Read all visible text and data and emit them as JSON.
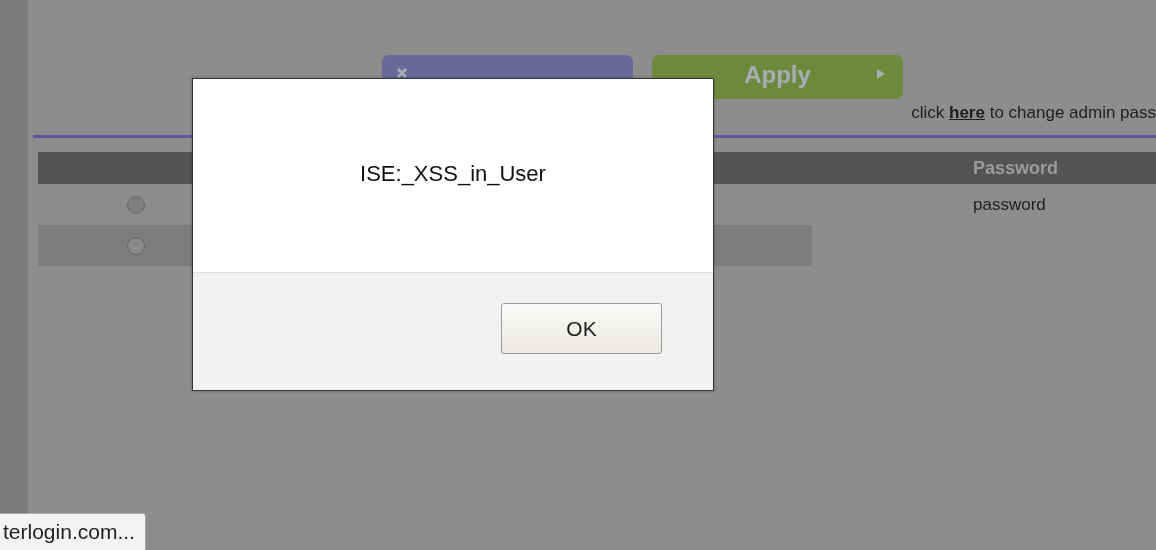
{
  "actions": {
    "buttons": [
      {
        "kind": "cancel"
      },
      {
        "kind": "apply",
        "label": "Apply"
      }
    ],
    "link_text": "click **here** to change admin pass"
  },
  "table": {
    "columns": [
      {
        "label": "Password"
      }
    ],
    "rows": [
      {
        "selected": false,
        "password": "password"
      },
      {
        "selected": false,
        "password": ""
      }
    ]
  },
  "dialog": {
    "message": "ISE:_XSS_in_User",
    "button": "OK"
  },
  "status_bar": {
    "text": "terlogin.com..."
  }
}
